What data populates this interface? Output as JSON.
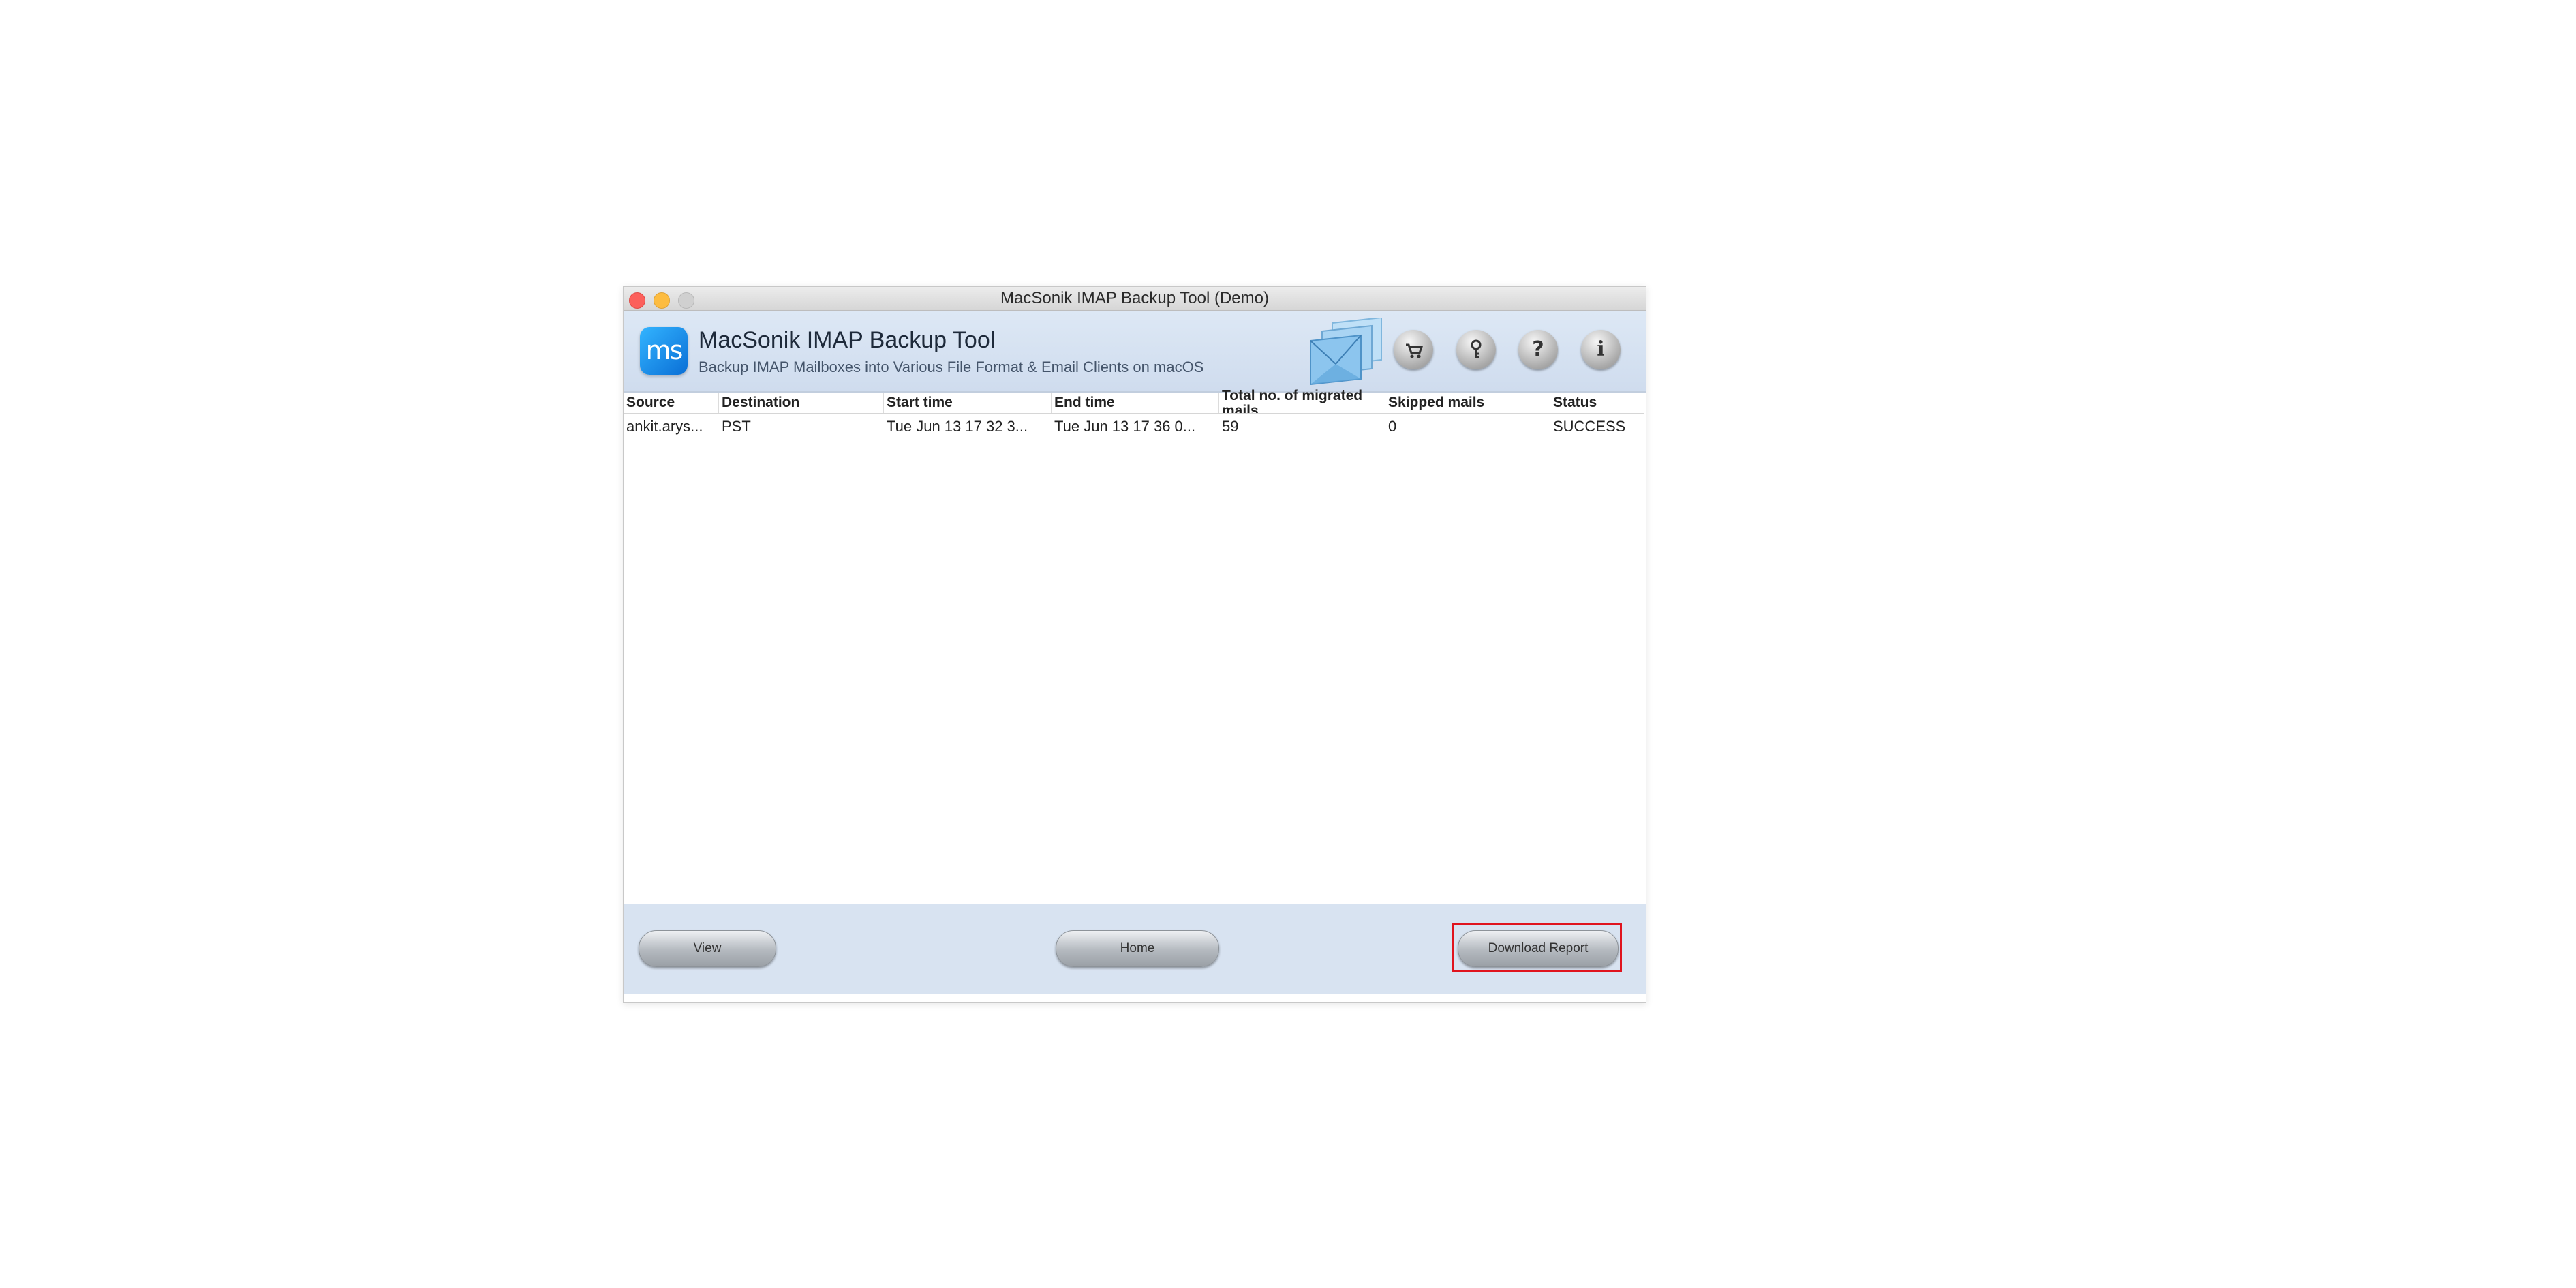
{
  "window": {
    "title": "MacSonik IMAP Backup Tool (Demo)"
  },
  "header": {
    "logo_text": "ms",
    "app_title": "MacSonik IMAP Backup Tool",
    "app_subtitle": "Backup IMAP Mailboxes into Various File Format & Email Clients on macOS",
    "toolbar_icons": [
      "cart-icon",
      "key-icon",
      "help-icon",
      "info-icon"
    ],
    "help_glyph": "?",
    "info_glyph": "i"
  },
  "table": {
    "columns": [
      "Source",
      "Destination",
      "Start time",
      "End time",
      "Total no. of migrated mails",
      "Skipped mails",
      "Status"
    ],
    "rows": [
      [
        "ankit.arys...",
        "PST",
        "Tue Jun 13 17 32 3...",
        "Tue Jun 13 17 36 0...",
        "59",
        "0",
        "SUCCESS"
      ]
    ]
  },
  "footer": {
    "view_label": "View",
    "home_label": "Home",
    "download_label": "Download Report"
  },
  "colors": {
    "accent": "#0a6fd6",
    "highlight": "#e0141e",
    "header_bg": "#dde8f5",
    "footer_bg": "#d8e3f1"
  }
}
